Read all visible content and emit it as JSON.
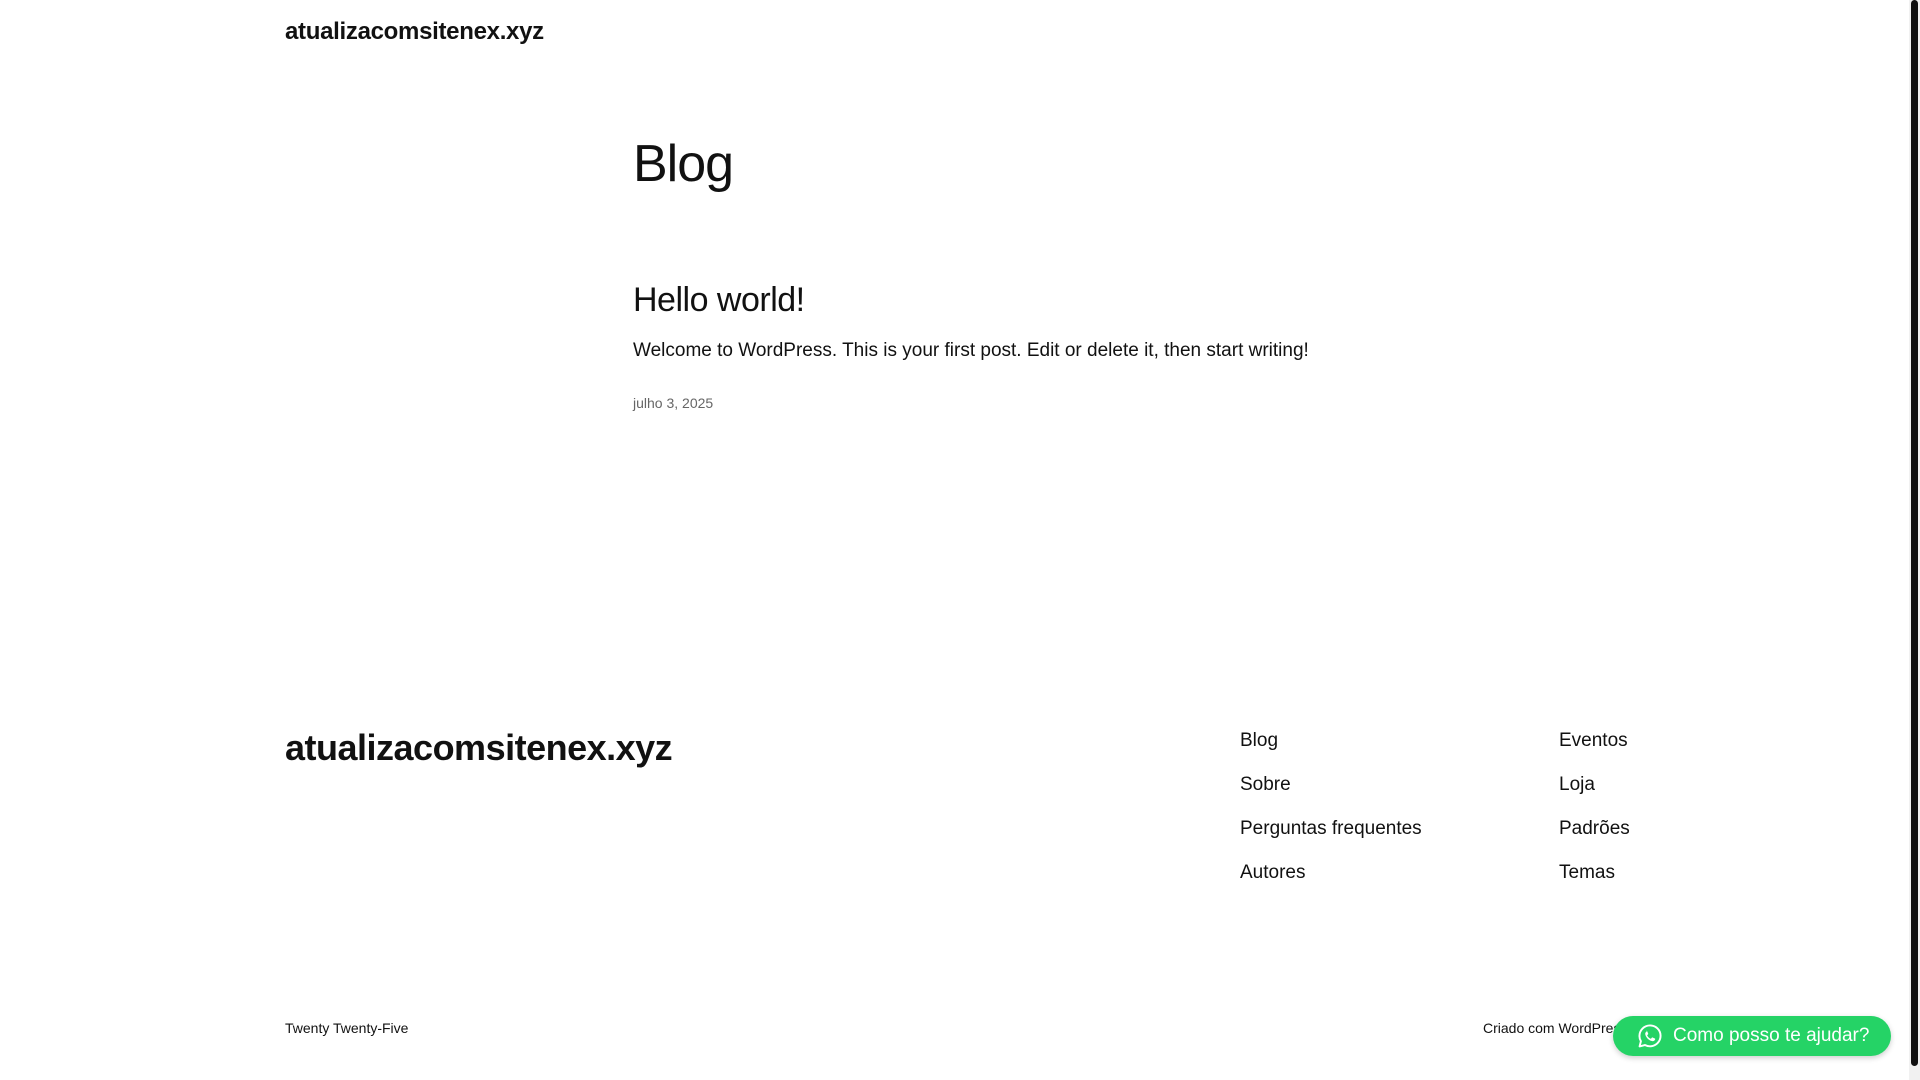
{
  "header": {
    "site_title": "atualizacomsitenex.xyz"
  },
  "main": {
    "heading": "Blog",
    "posts": [
      {
        "title": "Hello world!",
        "excerpt": "Welcome to WordPress. This is your first post. Edit or delete it, then start writing!",
        "date": "julho 3, 2025"
      }
    ]
  },
  "footer": {
    "site_title": "atualizacomsitenex.xyz",
    "nav_col_1": [
      "Blog",
      "Sobre",
      "Perguntas frequentes",
      "Autores"
    ],
    "nav_col_2": [
      "Eventos",
      "Loja",
      "Padrões",
      "Temas"
    ],
    "credit_left": "Twenty Twenty-Five",
    "credit_right": "Criado com WordPress"
  },
  "whatsapp": {
    "label": "Como posso te ajudar?",
    "icon": "whatsapp-icon",
    "color": "#25d366"
  }
}
